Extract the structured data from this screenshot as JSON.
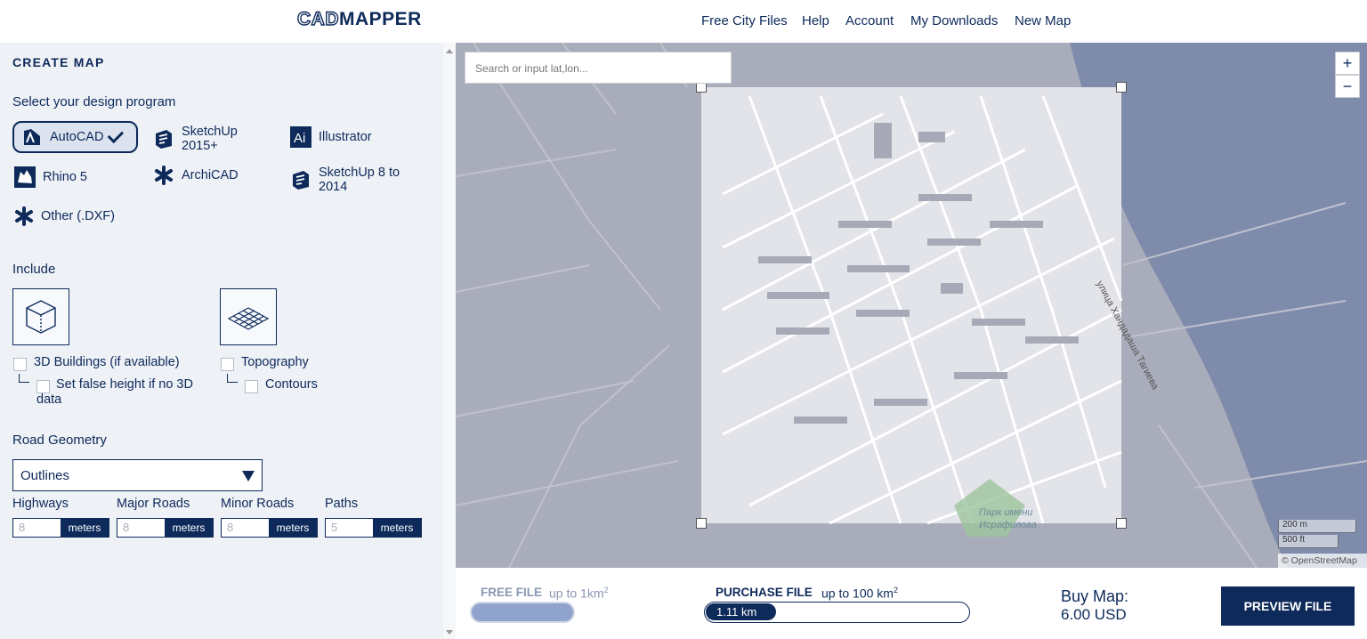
{
  "navbar": {
    "logo_left": "CAD",
    "logo_right": "MAPPER",
    "links": [
      "Free City Files",
      "Help",
      "Account",
      "My Downloads",
      "New Map"
    ]
  },
  "sidebar": {
    "title": "CREATE MAP",
    "program_heading": "Select your design program",
    "programs": [
      {
        "label": "AutoCAD",
        "icon": "autocad-icon",
        "selected": true
      },
      {
        "label": "SketchUp 2015+",
        "icon": "sketchup-icon",
        "selected": false
      },
      {
        "label": "Illustrator",
        "icon": "illustrator-icon",
        "selected": false
      },
      {
        "label": "Rhino 5",
        "icon": "rhino-icon",
        "selected": false
      },
      {
        "label": "ArchiCAD",
        "icon": "archicad-icon",
        "selected": false
      },
      {
        "label": "SketchUp 8 to 2014",
        "icon": "sketchup-icon",
        "selected": false
      },
      {
        "label": "Other (.DXF)",
        "icon": "asterisk-icon",
        "selected": false
      }
    ],
    "include_heading": "Include",
    "include": {
      "buildings_label": "3D Buildings (if available)",
      "false_height_label": "Set false height if no 3D data",
      "topography_label": "Topography",
      "contours_label": "Contours"
    },
    "road_heading": "Road Geometry",
    "road_select": "Outlines",
    "roads": [
      {
        "label": "Highways",
        "value": "8",
        "unit": "meters"
      },
      {
        "label": "Major Roads",
        "value": "8",
        "unit": "meters"
      },
      {
        "label": "Minor Roads",
        "value": "8",
        "unit": "meters"
      },
      {
        "label": "Paths",
        "value": "5",
        "unit": "meters"
      }
    ]
  },
  "map": {
    "search_placeholder": "Search or input lat,lon...",
    "zoom_in": "+",
    "zoom_out": "−",
    "street_label": "улица Хандадаша Тагиева",
    "park_label_1": "Парк имени",
    "park_label_2": "Исрафилова",
    "scale_metric": "200 m",
    "scale_imperial": "500 ft",
    "attribution": "© OpenStreetMap"
  },
  "bottom": {
    "free_title": "FREE FILE",
    "free_sub": "up to 1km",
    "purchase_title": "PURCHASE FILE",
    "purchase_sub": "up to 100 km",
    "sup": "2",
    "area": "1.11 km",
    "purchase_progress": 0.27,
    "buy_label": "Buy Map:",
    "buy_price": "6.00 USD",
    "preview_button": "PREVIEW FILE"
  },
  "colors": {
    "brand": "#0d2a5a",
    "water": "#7f8bab",
    "selection": "#e3e4e9"
  }
}
